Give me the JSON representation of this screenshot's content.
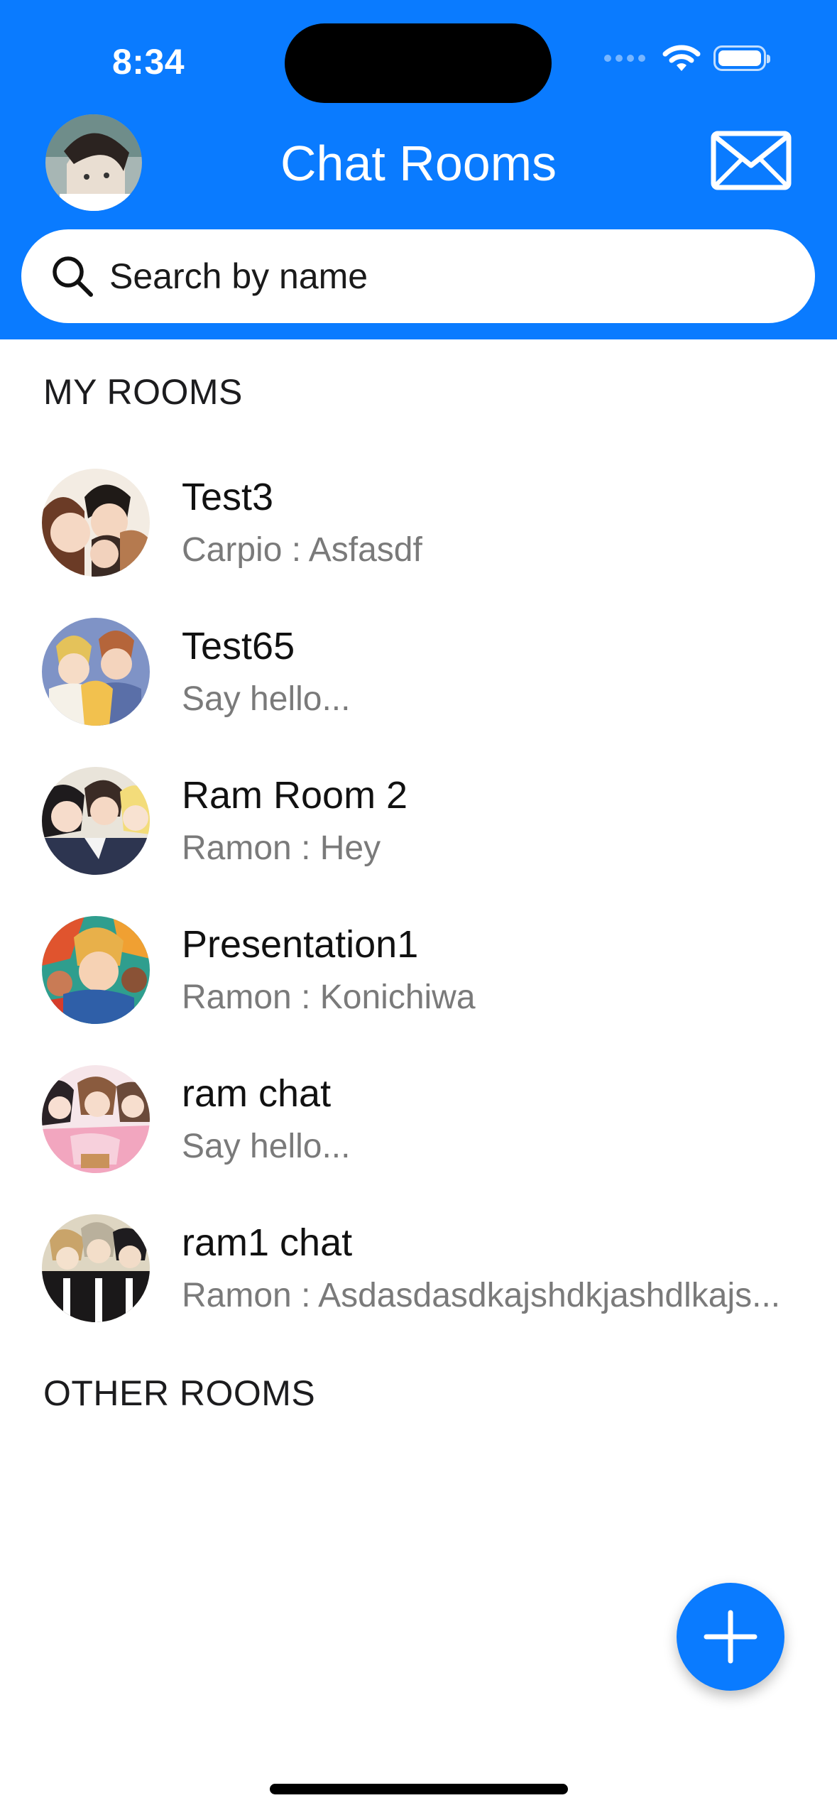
{
  "status_bar": {
    "time": "8:34"
  },
  "header": {
    "title": "Chat Rooms",
    "profile_avatar_icon": "user-avatar",
    "mail_icon": "envelope-icon"
  },
  "search": {
    "placeholder": "Search by name",
    "value": ""
  },
  "sections": {
    "my_rooms": "MY ROOMS",
    "other_rooms": "OTHER ROOMS"
  },
  "rooms": [
    {
      "name": "Test3",
      "preview": "Carpio : Asfasdf"
    },
    {
      "name": "Test65",
      "preview": "Say hello..."
    },
    {
      "name": "Ram Room 2",
      "preview": "Ramon : Hey"
    },
    {
      "name": "Presentation1",
      "preview": "Ramon : Konichiwa"
    },
    {
      "name": "ram chat",
      "preview": "Say hello..."
    },
    {
      "name": "ram1 chat",
      "preview": "Ramon : Asdasdasdkajshdkjashdlkajs..."
    }
  ],
  "fab": {
    "icon": "plus-icon"
  },
  "colors": {
    "accent": "#0a7bff",
    "secondary_text": "#7a7a7a"
  }
}
